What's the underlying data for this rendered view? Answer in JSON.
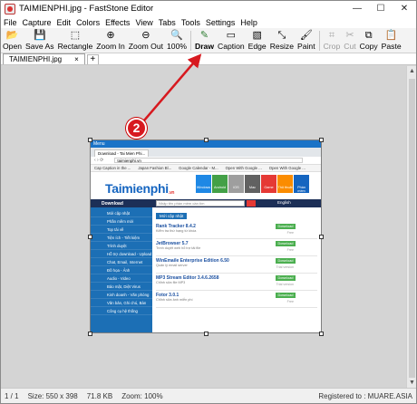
{
  "window": {
    "title": "TAIMIENPHI.jpg - FastStone Editor",
    "min": "—",
    "max": "☐",
    "close": "✕"
  },
  "menu": [
    "File",
    "Capture",
    "Edit",
    "Colors",
    "Effects",
    "View",
    "Tabs",
    "Tools",
    "Settings",
    "Help"
  ],
  "toolbar": [
    {
      "label": "Open",
      "icon": "folder-open-icon",
      "glyph": "📂",
      "enabled": true
    },
    {
      "label": "Save As",
      "icon": "save-icon",
      "glyph": "💾",
      "enabled": true
    },
    {
      "label": "Rectangle",
      "icon": "rectangle-select-icon",
      "glyph": "⬚",
      "enabled": true
    },
    {
      "label": "Zoom In",
      "icon": "zoom-in-icon",
      "glyph": "⊕",
      "enabled": true
    },
    {
      "label": "Zoom Out",
      "icon": "zoom-out-icon",
      "glyph": "⊖",
      "enabled": true
    },
    {
      "label": "100%",
      "icon": "zoom-100-icon",
      "glyph": "🔍",
      "enabled": true
    },
    {
      "label": "Draw",
      "icon": "draw-pen-icon",
      "glyph": "✎",
      "enabled": true
    },
    {
      "label": "Caption",
      "icon": "caption-icon",
      "glyph": "▭",
      "enabled": true
    },
    {
      "label": "Edge",
      "icon": "edge-icon",
      "glyph": "▧",
      "enabled": true
    },
    {
      "label": "Resize",
      "icon": "resize-icon",
      "glyph": "⤡",
      "enabled": true
    },
    {
      "label": "Paint",
      "icon": "paint-icon",
      "glyph": "🖌",
      "enabled": true
    },
    {
      "label": "Crop",
      "icon": "crop-icon",
      "glyph": "⌗",
      "enabled": false
    },
    {
      "label": "Cut",
      "icon": "cut-icon",
      "glyph": "✂",
      "enabled": false
    },
    {
      "label": "Copy",
      "icon": "copy-icon",
      "glyph": "⧉",
      "enabled": true
    },
    {
      "label": "Paste",
      "icon": "paste-icon",
      "glyph": "📋",
      "enabled": true
    }
  ],
  "tabs": [
    {
      "label": "TAIMIENPHI.jpg",
      "close": "×"
    }
  ],
  "tab_add": "+",
  "annotation": {
    "badge": "2",
    "color": "#d7191f"
  },
  "screenshot": {
    "browser_title": "Menu",
    "browser_tabs": [
      "Download - Tai Mien Phi..."
    ],
    "address": "taimienphi.vn",
    "bookmarks": [
      "Cap Caption in the ...",
      "Japan Fashion Bl...",
      "Google Calendar - M...",
      "Open With Google ...",
      "Open With Google ..."
    ],
    "logo": "Taimienphi",
    "logo_suffix": ".vn",
    "tiles": [
      {
        "label": "Windows",
        "color": "#1e88e5"
      },
      {
        "label": "Android",
        "color": "#43a047"
      },
      {
        "label": "iOS",
        "color": "#9e9e9e"
      },
      {
        "label": "Mac",
        "color": "#616161"
      },
      {
        "label": "Game",
        "color": "#e53935"
      },
      {
        "label": "Thủ thuật",
        "color": "#fb8c00"
      },
      {
        "label": "Phần mềm",
        "color": "#1565c0"
      }
    ],
    "nav_download": "Download",
    "search_placeholder": "Nhập tên phần mềm cần tìm",
    "nav_lang": "English",
    "sidebar": [
      "Mới cập nhật",
      "Phần mềm mới",
      "Top tải về",
      "Tiện ích - Tiết kiệm",
      "Trình duyệt",
      "Hỗ trợ download - Upload",
      "Chat, Email, Internet",
      "Đồ họa - Ảnh",
      "Audio - Video",
      "Bảo mật, Diệt Virus",
      "Kinh doanh - Văn phòng",
      "Văn bản, Ghi chú, Bàn",
      "Công cụ hệ thống"
    ],
    "content_tab": "Mới cập nhật",
    "entries": [
      {
        "name": "Rank Tracker 8.4.2",
        "desc": "Kiểm tra thứ hạng từ khóa",
        "btn": "Download",
        "ver": "Free"
      },
      {
        "name": "JetBrowser 5.7",
        "desc": "Trình duyệt web hỗ trợ tải file",
        "btn": "Download",
        "ver": "Free"
      },
      {
        "name": "WinEmaile Enterprise Edition 6.50",
        "desc": "Quản lý email server",
        "btn": "Download",
        "ver": "Trial version"
      },
      {
        "name": "MP3 Stream Editor 3.4.6.2658",
        "desc": "Chỉnh sửa file MP3",
        "btn": "Download",
        "ver": "Trial version"
      },
      {
        "name": "Fotor 3.0.1",
        "desc": "Chỉnh sửa ảnh miễn phí",
        "btn": "Download",
        "ver": "Free"
      }
    ]
  },
  "status": {
    "page": "1 / 1",
    "size": "Size: 550 x 398",
    "file": "71.8 KB",
    "zoom": "Zoom: 100%",
    "registered": "Registered to : MUARE.ASIA"
  }
}
